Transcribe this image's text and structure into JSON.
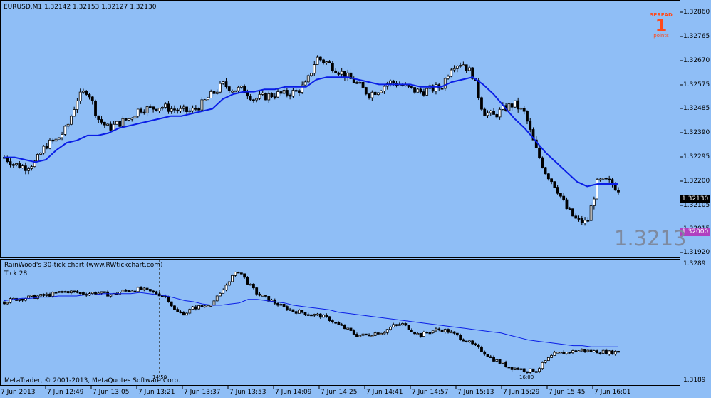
{
  "header": {
    "symbol_line": "EURUSD,M1  1.32142 1.32153 1.32127 1.32130"
  },
  "spread": {
    "label": "SPREAD",
    "value": "1",
    "unit": "points"
  },
  "main_axis": {
    "ticks": [
      "1.32860",
      "1.32765",
      "1.32670",
      "1.32575",
      "1.32485",
      "1.32390",
      "1.32295",
      "1.32200",
      "1.32105",
      "1.32015",
      "1.31920"
    ],
    "current_price": "1.32130",
    "level_price": "1.32000",
    "big_price": "1.3213"
  },
  "sub_window": {
    "title": "RainWood's 30-tick chart  (www.RWtickchart.com)",
    "subtitle": "Tick 28",
    "axis_top": "1.3289",
    "axis_bottom": "1.3189",
    "marker_left": "14:50",
    "marker_right": "16:00",
    "copyright": "MetaTrader, © 2001-2013, MetaQuotes Software Corp."
  },
  "time_axis": [
    "7 Jun 2013",
    "7 Jun 12:49",
    "7 Jun 13:05",
    "7 Jun 13:21",
    "7 Jun 13:37",
    "7 Jun 13:53",
    "7 Jun 14:09",
    "7 Jun 14:25",
    "7 Jun 14:41",
    "7 Jun 14:57",
    "7 Jun 15:13",
    "7 Jun 15:29",
    "7 Jun 15:45",
    "7 Jun 16:01"
  ],
  "colors": {
    "background": "#8fbef6",
    "ma_line": "#0a1ee6",
    "level_line": "#b040c0",
    "price_badge": "#000000",
    "level_badge": "#b040c0",
    "spread": "#ff4a1a",
    "big_price": "#7e8aa0"
  },
  "chart_data": [
    {
      "type": "candlestick",
      "title": "EURUSD,M1  1.32142 1.32153 1.32127 1.32130",
      "ylim": [
        1.3188,
        1.3289
      ],
      "series": [
        {
          "values": [
            1.3226,
            1.3223,
            1.3222,
            1.3224,
            1.3231,
            1.3233,
            1.3238,
            1.325,
            1.3254,
            1.3242,
            1.3238,
            1.324,
            1.3242,
            1.3246,
            1.3246,
            1.3247,
            1.3246,
            1.3245,
            1.3245,
            1.3248,
            1.3252,
            1.3256,
            1.3254,
            1.3254,
            1.325,
            1.3251,
            1.3252,
            1.3252,
            1.3253,
            1.3256,
            1.3267,
            1.3265,
            1.3262,
            1.3259,
            1.3256,
            1.3252,
            1.3254,
            1.3257,
            1.3256,
            1.3254,
            1.3253,
            1.3254,
            1.3255,
            1.3264,
            1.3265,
            1.326,
            1.3245,
            1.3243,
            1.3246,
            1.3248,
            1.3244,
            1.323,
            1.322,
            1.3214,
            1.3205,
            1.32,
            1.3199,
            1.3216,
            1.3216,
            1.3213
          ]
        },
        {
          "values": [
            1.3226,
            1.3226,
            1.3225,
            1.3224,
            1.3225,
            1.3229,
            1.3232,
            1.3233,
            1.3235,
            1.3235,
            1.3236,
            1.3238,
            1.3239,
            1.324,
            1.3241,
            1.3242,
            1.3243,
            1.3243,
            1.3244,
            1.3245,
            1.3246,
            1.325,
            1.3252,
            1.3253,
            1.3253,
            1.3254,
            1.3254,
            1.3255,
            1.3255,
            1.3255,
            1.3258,
            1.3259,
            1.3259,
            1.3259,
            1.3258,
            1.3257,
            1.3256,
            1.3256,
            1.3256,
            1.3256,
            1.3255,
            1.3255,
            1.3255,
            1.3257,
            1.3258,
            1.3259,
            1.3256,
            1.3252,
            1.3247,
            1.3242,
            1.3238,
            1.3233,
            1.3228,
            1.3224,
            1.322,
            1.3216,
            1.3214,
            1.3215,
            1.3215,
            1.3215
          ]
        }
      ]
    },
    {
      "type": "candlestick",
      "title": "RainWood's 30-tick chart  (www.RWtickchart.com)",
      "ylim": [
        1.3189,
        1.3289
      ],
      "series": [
        {
          "values": [
            1.3255,
            1.3257,
            1.3258,
            1.3259,
            1.326,
            1.3261,
            1.3263,
            1.3264,
            1.3263,
            1.3262,
            1.3263,
            1.3262,
            1.3261,
            1.3264,
            1.3265,
            1.3266,
            1.3264,
            1.3262,
            1.3259,
            1.3246,
            1.3245,
            1.325,
            1.3251,
            1.3254,
            1.3262,
            1.3275,
            1.3282,
            1.3271,
            1.3262,
            1.3258,
            1.3254,
            1.325,
            1.3247,
            1.3246,
            1.3244,
            1.3243,
            1.324,
            1.3235,
            1.3231,
            1.3226,
            1.3226,
            1.3228,
            1.3229,
            1.3234,
            1.3236,
            1.3231,
            1.3226,
            1.3229,
            1.3231,
            1.323,
            1.3226,
            1.3222,
            1.3217,
            1.3212,
            1.3206,
            1.3202,
            1.3198,
            1.3197,
            1.3195,
            1.3196,
            1.3204,
            1.321,
            1.3211,
            1.3212,
            1.3213,
            1.3212,
            1.3212,
            1.3211,
            1.3212
          ]
        },
        {
          "values": [
            1.3256,
            1.3257,
            1.3258,
            1.3258,
            1.3259,
            1.3259,
            1.326,
            1.326,
            1.326,
            1.3261,
            1.3261,
            1.3262,
            1.3262,
            1.3262,
            1.3262,
            1.3263,
            1.3262,
            1.3261,
            1.326,
            1.3258,
            1.3256,
            1.3255,
            1.3253,
            1.3252,
            1.3252,
            1.3253,
            1.3254,
            1.3257,
            1.3257,
            1.3256,
            1.3255,
            1.3254,
            1.3252,
            1.3251,
            1.325,
            1.3249,
            1.3248,
            1.3246,
            1.3245,
            1.3244,
            1.3243,
            1.3242,
            1.3241,
            1.324,
            1.3239,
            1.3238,
            1.3237,
            1.3236,
            1.3235,
            1.3234,
            1.3233,
            1.3232,
            1.3231,
            1.323,
            1.3229,
            1.3228,
            1.3226,
            1.3224,
            1.3222,
            1.3221,
            1.322,
            1.3219,
            1.3218,
            1.3217,
            1.3217,
            1.3216,
            1.3216,
            1.3216,
            1.3216
          ]
        }
      ]
    }
  ]
}
